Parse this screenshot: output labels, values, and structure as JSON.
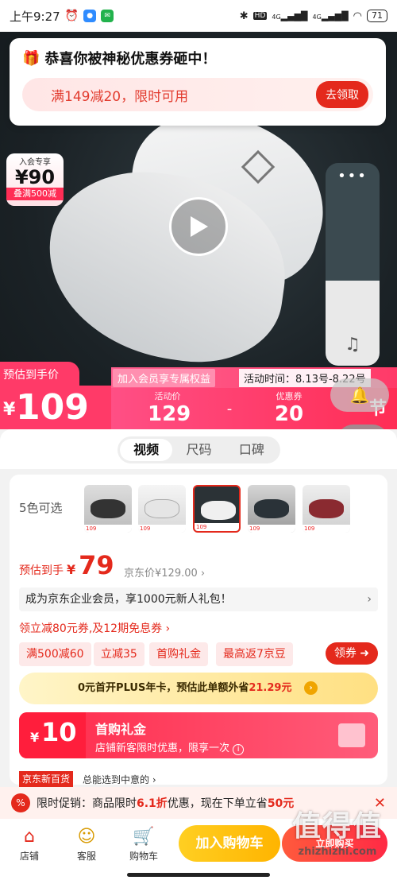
{
  "status_bar": {
    "time": "上午9:27",
    "hd": "HD",
    "net1": "4G",
    "net2": "4G",
    "battery": "71"
  },
  "coupon_popup": {
    "title": "恭喜你被神秘优惠券砸中！",
    "offer": "满149减20，限时可用",
    "button": "去领取"
  },
  "member_badge": {
    "label": "入会专享",
    "price": "90",
    "stack": "叠满500减"
  },
  "price_banner": {
    "estimate_label": "预估到手价",
    "currency": "¥",
    "price": "109",
    "member_promo": "加入会员享专属权益",
    "activity_time": "活动时间：8.13号-8.22号",
    "activity_price_label": "活动价",
    "activity_price": "129",
    "dash": "-",
    "coupon_label": "优惠券",
    "coupon_value": "20",
    "partial_text": "节"
  },
  "tabs": [
    "视频",
    "尺码",
    "口碑"
  ],
  "product": {
    "color_count": "5色可选",
    "thumb_tag": "109",
    "estimate_label": "预估到手",
    "estimate_currency": "¥",
    "estimate_price": "79",
    "jd_price": "京东价¥129.00",
    "enterprise_offer": "成为京东企业会员，享1000元新人礼包！",
    "coupon_line": "领立减80元券,及12期免息券",
    "chips": [
      "满500减60",
      "立减35",
      "首购礼金",
      "最高返7京豆"
    ],
    "get_coupon": "领券",
    "plus_text_a": "0元首开PLUS年卡，预估此单额外省",
    "plus_amount": "21.29元",
    "first_buy_currency": "¥",
    "first_buy_amount": "10",
    "first_buy_title": "首购礼金",
    "first_buy_desc": "店铺新客限时优惠，限享一次",
    "jd_new_tag": "京东新百货",
    "jd_new_desc": "总能选到中意的"
  },
  "promo_strip": {
    "pct": "%",
    "text_a": "限时促销：商品限时",
    "discount": "6.1折",
    "text_b": "优惠，现在下单立省",
    "save": "50元"
  },
  "bottom_nav": {
    "store": "店铺",
    "service": "客服",
    "cart": "购物车",
    "add_to_cart": "加入购物车",
    "buy_now": "立即购买"
  },
  "watermark": {
    "big": "值得值",
    "small": "zhizhizhi.com"
  },
  "colors": {
    "accent": "#e4291c",
    "pink": "#ff3a68",
    "yellow": "#ffb400"
  }
}
